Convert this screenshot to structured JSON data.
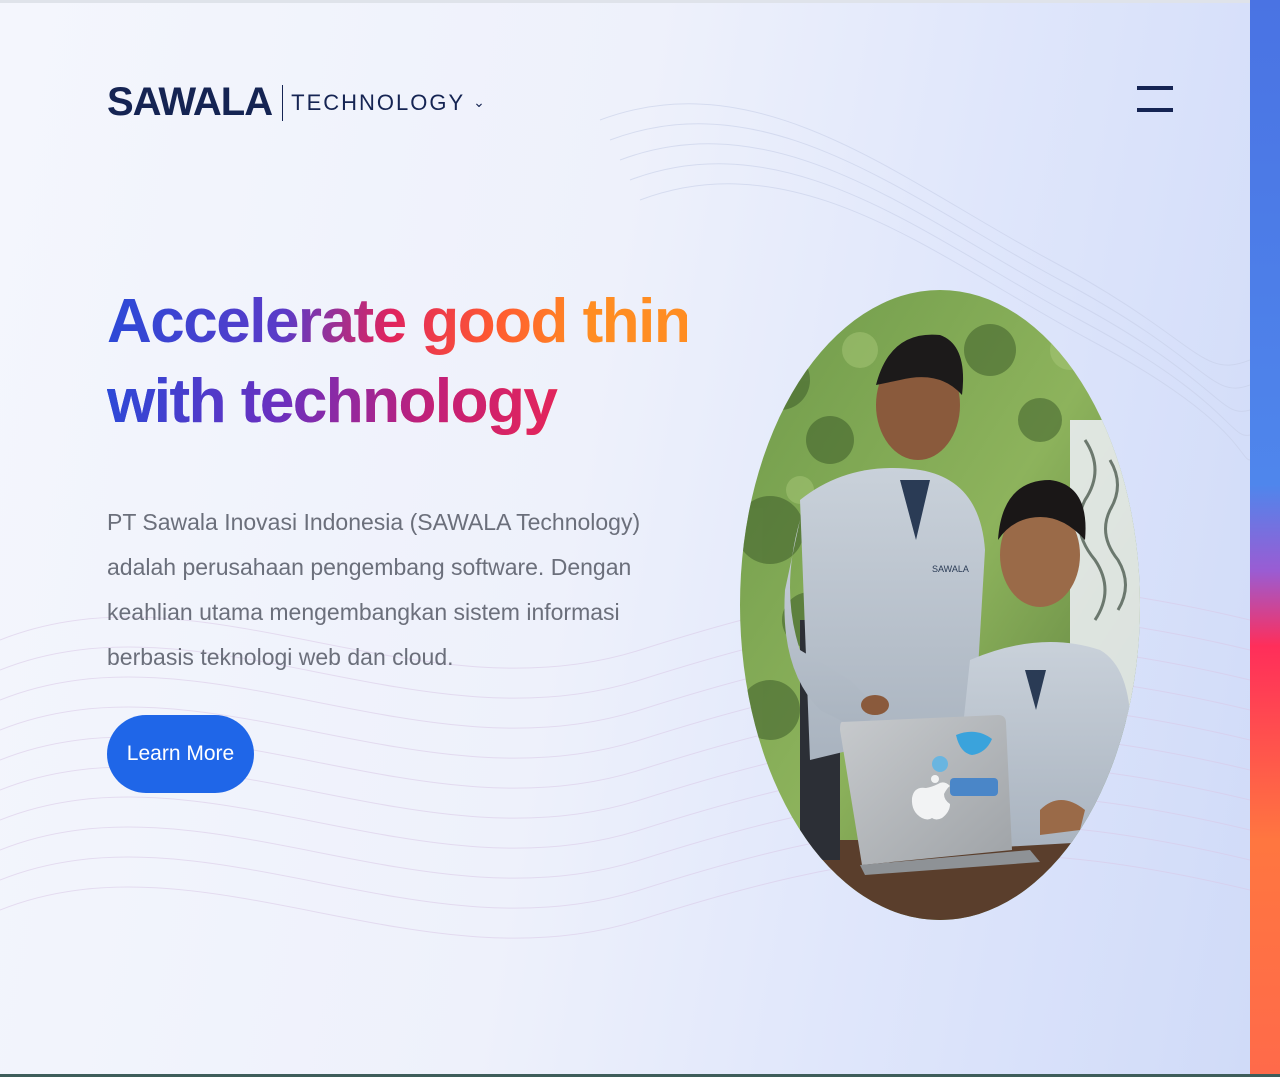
{
  "header": {
    "logo_main": "SAWALA",
    "logo_sub": "TECHNOLOGY",
    "logo_chevron": "⌄",
    "menu_icon": "hamburger-menu-icon"
  },
  "hero": {
    "headline_line1": "Accelerate good things",
    "headline_line2": "with technology",
    "description": "PT Sawala Inovasi Indonesia (SAWALA Technology) adalah perusahaan pengembang software. Dengan keahlian utama mengembangkan sistem informasi berbasis teknologi web dan cloud.",
    "cta_label": "Learn More"
  },
  "photo": {
    "shirt_text": "SAWALA"
  },
  "colors": {
    "brand_navy": "#152453",
    "cta_blue": "#1f66e8",
    "gradient_blue": "#2a4ad8",
    "gradient_pink": "#e0245e",
    "gradient_orange": "#ff8d22"
  }
}
